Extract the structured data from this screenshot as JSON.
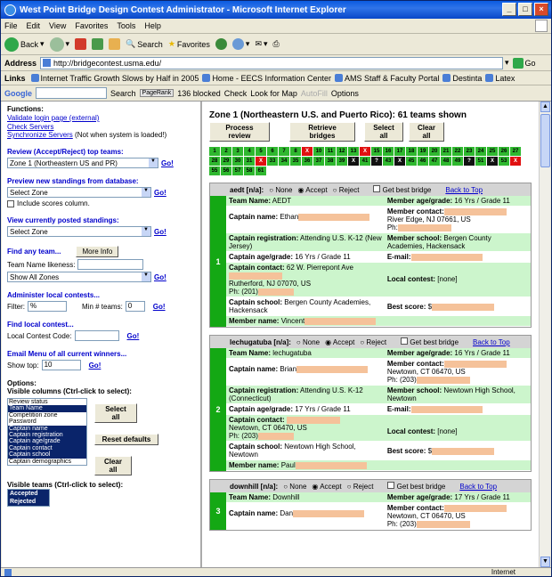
{
  "window": {
    "title": "West Point Bridge Design Contest Administrator - Microsoft Internet Explorer"
  },
  "menu": [
    "File",
    "Edit",
    "View",
    "Favorites",
    "Tools",
    "Help"
  ],
  "toolbar": {
    "back": "Back",
    "search": "Search",
    "favorites": "Favorites"
  },
  "address": {
    "label": "Address",
    "url": "http://bridgecontest.usma.edu/",
    "go": "Go"
  },
  "links": {
    "label": "Links",
    "items": [
      "Internet Traffic Growth Slows by Half in 2005",
      "Home - EECS Information Center",
      "AMS Staff & Faculty Portal",
      "Destinta",
      "Latex"
    ]
  },
  "google": {
    "label": "Google",
    "search": "Search",
    "pagerank": "PageRank",
    "blocked": "136 blocked",
    "check": "Check",
    "lookfor": "Look for Map",
    "autofill": "AutoFill",
    "options": "Options"
  },
  "left": {
    "functions": "Functions:",
    "validate": "Validate login page (external)",
    "check": "Check Servers",
    "sync": "Synchronize Servers",
    "sync_note": "(Not when system is loaded!)",
    "review_title": "Review (Accept/Reject) top teams:",
    "review_select": "Zone 1 (Northeastern US and PR)",
    "go": "Go!",
    "preview_title": "Preview new standings from database:",
    "preview_select": "Select Zone",
    "include_scores": "Include scores column.",
    "posted_title": "View currently posted standings:",
    "posted_select": "Select Zone",
    "findany_title": "Find any team...",
    "more_info": "More Info",
    "team_likeness": "Team Name likeness:",
    "show_zones": "Show All Zones",
    "admin_title": "Administer local contests...",
    "filter_label": "Filter:",
    "filter_value": "%",
    "min_label": "Min # teams:",
    "min_value": "0",
    "findlocal_title": "Find local contest...",
    "local_code": "Local Contest Code:",
    "email_title": "Email Menu of all current winners...",
    "show_top": "Show top:",
    "show_top_value": "10",
    "options": "Options:",
    "visible_cols": "Visible columns (Ctrl-click to select):",
    "columns": [
      {
        "label": "Review status",
        "on": false
      },
      {
        "label": "Team Name",
        "on": true
      },
      {
        "label": "Competition zone",
        "on": false
      },
      {
        "label": "Password",
        "on": false
      },
      {
        "label": "Captain name",
        "on": true
      },
      {
        "label": "Captain registration",
        "on": true
      },
      {
        "label": "Captain age/grade",
        "on": true
      },
      {
        "label": "Captain contact",
        "on": true
      },
      {
        "label": "Captain school",
        "on": true
      },
      {
        "label": "Captain demographics",
        "on": false
      },
      {
        "label": "Member name",
        "on": true
      }
    ],
    "select_all": "Select all",
    "reset_defaults": "Reset defaults",
    "clear_all": "Clear all",
    "visible_teams": "Visible teams (Ctrl-click to select):",
    "teams_filter": [
      "Accepted",
      "Rejected"
    ]
  },
  "right": {
    "heading": "Zone 1 (Northeastern U.S. and Puerto Rico): 61 teams shown",
    "buttons": [
      "Process review",
      "Retrieve bridges",
      "Select all",
      "Clear all"
    ],
    "cells": [
      {
        "n": "1",
        "s": "g"
      },
      {
        "n": "2",
        "s": "g"
      },
      {
        "n": "3",
        "s": "g"
      },
      {
        "n": "4",
        "s": "g"
      },
      {
        "n": "5",
        "s": "g"
      },
      {
        "n": "6",
        "s": "g"
      },
      {
        "n": "7",
        "s": "g"
      },
      {
        "n": "8",
        "s": "g"
      },
      {
        "n": "X",
        "s": "r"
      },
      {
        "n": "10",
        "s": "g"
      },
      {
        "n": "11",
        "s": "g"
      },
      {
        "n": "12",
        "s": "g"
      },
      {
        "n": "13",
        "s": "g"
      },
      {
        "n": "X",
        "s": "r"
      },
      {
        "n": "15",
        "s": "g"
      },
      {
        "n": "16",
        "s": "g"
      },
      {
        "n": "17",
        "s": "g"
      },
      {
        "n": "18",
        "s": "g"
      },
      {
        "n": "19",
        "s": "g"
      },
      {
        "n": "20",
        "s": "g"
      },
      {
        "n": "21",
        "s": "g"
      },
      {
        "n": "22",
        "s": "g"
      },
      {
        "n": "23",
        "s": "g"
      },
      {
        "n": "24",
        "s": "g"
      },
      {
        "n": "25",
        "s": "g"
      },
      {
        "n": "26",
        "s": "g"
      },
      {
        "n": "27",
        "s": "g"
      },
      {
        "n": "28",
        "s": "g"
      },
      {
        "n": "29",
        "s": "g"
      },
      {
        "n": "30",
        "s": "g"
      },
      {
        "n": "31",
        "s": "g"
      },
      {
        "n": "X",
        "s": "r"
      },
      {
        "n": "33",
        "s": "g"
      },
      {
        "n": "34",
        "s": "g"
      },
      {
        "n": "35",
        "s": "g"
      },
      {
        "n": "36",
        "s": "g"
      },
      {
        "n": "37",
        "s": "g"
      },
      {
        "n": "38",
        "s": "g"
      },
      {
        "n": "39",
        "s": "g"
      },
      {
        "n": "X",
        "s": "k"
      },
      {
        "n": "41",
        "s": "g"
      },
      {
        "n": "?",
        "s": "k"
      },
      {
        "n": "43",
        "s": "g"
      },
      {
        "n": "X",
        "s": "k"
      },
      {
        "n": "45",
        "s": "g"
      },
      {
        "n": "46",
        "s": "g"
      },
      {
        "n": "47",
        "s": "g"
      },
      {
        "n": "48",
        "s": "g"
      },
      {
        "n": "49",
        "s": "g"
      },
      {
        "n": "?",
        "s": "k"
      },
      {
        "n": "51",
        "s": "g"
      },
      {
        "n": "X",
        "s": "k"
      },
      {
        "n": "53",
        "s": "g"
      },
      {
        "n": "X",
        "s": "r"
      },
      {
        "n": "55",
        "s": "g"
      },
      {
        "n": "56",
        "s": "g"
      },
      {
        "n": "57",
        "s": "g"
      },
      {
        "n": "58",
        "s": "g"
      },
      {
        "n": "61",
        "s": "g"
      }
    ],
    "review_opts": {
      "none": "None",
      "accept": "Accept",
      "reject": "Reject",
      "best": "Get best bridge",
      "top": "Back to Top"
    },
    "teams": [
      {
        "num": "1",
        "id": "aedt [n/a]:",
        "name_lbl": "Team Name:",
        "name": "AEDT",
        "mag_lbl": "Member age/grade:",
        "mag": "16 Yrs / Grade 11",
        "cap_lbl": "Captain name:",
        "cap": "Ethan",
        "mc_lbl": "Member contact:",
        "mc": "River Edge, NJ 07661, US",
        "mc_ph": "Ph:",
        "reg_lbl": "Captain registration:",
        "reg": "Attending U.S. K-12 (New Jersey)",
        "ms_lbl": "Member school:",
        "ms": "Bergen County Academies, Hackensack",
        "cag_lbl": "Captain age/grade:",
        "cag": "16 Yrs / Grade 11",
        "email_lbl": "E-mail:",
        "cc_lbl": "Captain contact:",
        "cc": "62 W. Pierrepont Ave",
        "cc2": "Rutherford, NJ 07070, US",
        "cc3": "Ph: (201)",
        "lc_lbl": "Local contest:",
        "lc": "[none]",
        "cs_lbl": "Captain school:",
        "cs": "Bergen County Academies, Hackensack",
        "bs_lbl": "Best score:",
        "bs": "$",
        "mn_lbl": "Member name:",
        "mn": "Vincent"
      },
      {
        "num": "2",
        "id": "lechugatuba [n/a]:",
        "name_lbl": "Team Name:",
        "name": "lechugatuba",
        "mag_lbl": "Member age/grade:",
        "mag": "16 Yrs / Grade 11",
        "cap_lbl": "Captain name:",
        "cap": "Brian",
        "mc_lbl": "Member contact:",
        "mc": "Newtown, CT 06470, US",
        "mc_ph": "Ph: (203)",
        "reg_lbl": "Captain registration:",
        "reg": "Attending U.S. K-12 (Connecticut)",
        "ms_lbl": "Member school:",
        "ms": "Newtown High School, Newtown",
        "cag_lbl": "Captain age/grade:",
        "cag": "17 Yrs / Grade 11",
        "email_lbl": "E-mail:",
        "cc_lbl": "Captain contact:",
        "cc": "",
        "cc2": "Newtown, CT 06470, US",
        "cc3": "Ph: (203)",
        "lc_lbl": "Local contest:",
        "lc": "[none]",
        "cs_lbl": "Captain school:",
        "cs": "Newtown High School, Newtown",
        "bs_lbl": "Best score:",
        "bs": "$",
        "mn_lbl": "Member name:",
        "mn": "Paul"
      },
      {
        "num": "3",
        "id": "downhill [n/a]:",
        "name_lbl": "Team Name:",
        "name": "Downhill",
        "mag_lbl": "Member age/grade:",
        "mag": "17 Yrs / Grade 11",
        "cap_lbl": "Captain name:",
        "cap": "Dan",
        "mc_lbl": "Member contact:",
        "mc": "Newtown, CT 06470, US",
        "mc_ph": "Ph: (203)"
      }
    ]
  },
  "status": {
    "zone": "Internet"
  }
}
